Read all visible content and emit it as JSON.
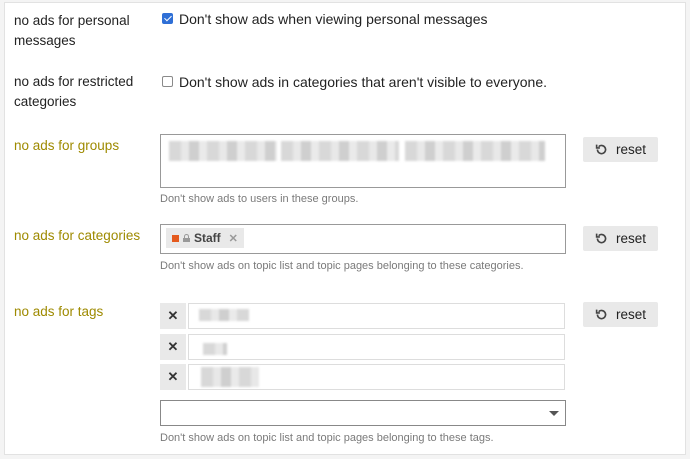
{
  "rows": {
    "personal": {
      "label": "no ads for personal messages",
      "checkbox_text": "Don't show ads when viewing personal messages",
      "checked": true
    },
    "restricted": {
      "label": "no ads for restricted categories",
      "checkbox_text": "Don't show ads in categories that aren't visible to everyone.",
      "checked": false
    },
    "groups": {
      "label": "no ads for groups",
      "help": "Don't show ads to users in these groups.",
      "reset_label": "reset"
    },
    "categories": {
      "label": "no ads for categories",
      "help": "Don't show ads on topic list and topic pages belonging to these categories.",
      "reset_label": "reset",
      "chip": "Staff"
    },
    "tags": {
      "label": "no ads for tags",
      "help": "Don't show ads on topic list and topic pages belonging to these tags.",
      "reset_label": "reset"
    }
  },
  "colors": {
    "label_olive": "#9e8a00",
    "checkbox_blue": "#2f6fd6",
    "category_color": "#e45a1e"
  },
  "icons": {
    "reset": "undo-icon",
    "remove": "x-icon",
    "lock": "lock-icon",
    "dropdown": "caret-down-icon"
  }
}
